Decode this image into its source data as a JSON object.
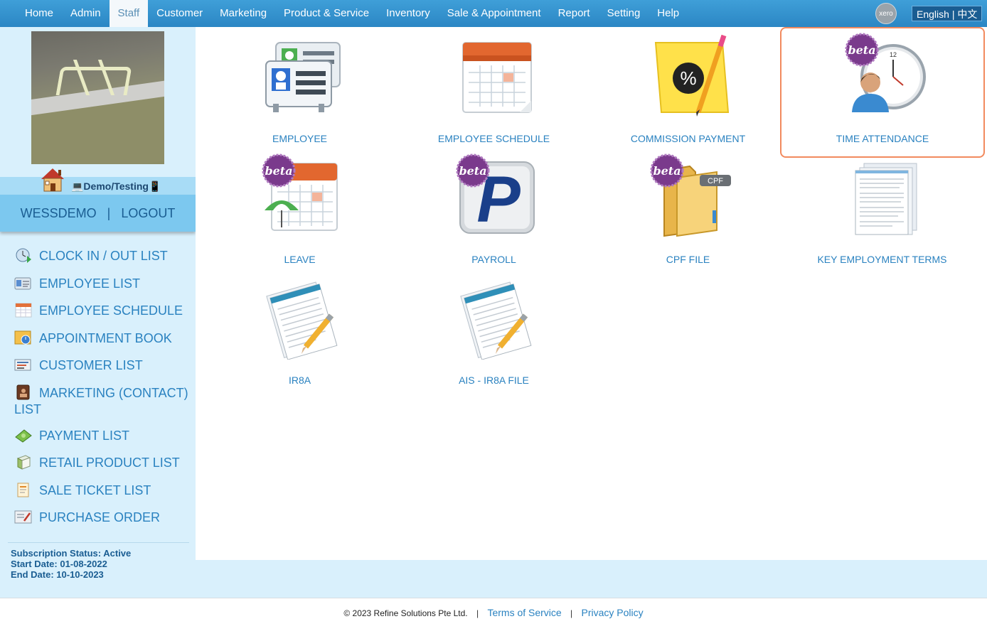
{
  "nav": {
    "items": [
      "Home",
      "Admin",
      "Staff",
      "Customer",
      "Marketing",
      "Product & Service",
      "Inventory",
      "Sale & Appointment",
      "Report",
      "Setting",
      "Help"
    ],
    "active_index": 2,
    "xero_label": "xero",
    "lang_english": "English",
    "lang_sep": "|",
    "lang_chinese": "中文"
  },
  "sidebar": {
    "shop_name": "💻Demo/Testing📱",
    "username": "WESSDEMO",
    "separator": "|",
    "logout": "LOGOUT",
    "items": [
      {
        "label": "CLOCK IN / OUT LIST",
        "icon": "clock-in-icon"
      },
      {
        "label": "EMPLOYEE LIST",
        "icon": "employee-card-icon"
      },
      {
        "label": "EMPLOYEE SCHEDULE",
        "icon": "calendar-icon"
      },
      {
        "label": "APPOINTMENT BOOK",
        "icon": "appointment-book-icon"
      },
      {
        "label": "CUSTOMER LIST",
        "icon": "customer-list-icon"
      },
      {
        "label": "MARKETING (CONTACT) LIST",
        "icon": "contact-book-icon"
      },
      {
        "label": "PAYMENT LIST",
        "icon": "money-icon"
      },
      {
        "label": "RETAIL PRODUCT LIST",
        "icon": "product-box-icon"
      },
      {
        "label": "SALE TICKET LIST",
        "icon": "sale-ticket-icon"
      },
      {
        "label": "PURCHASE ORDER",
        "icon": "purchase-order-icon"
      }
    ],
    "subscription": {
      "status": "Subscription Status: Active",
      "start": "Start Date: 01-08-2022",
      "end": "End Date: 10-10-2023"
    }
  },
  "tiles": [
    {
      "label": "EMPLOYEE",
      "icon": "employee-cards-icon",
      "beta": false
    },
    {
      "label": "EMPLOYEE SCHEDULE",
      "icon": "schedule-calendar-icon",
      "beta": false
    },
    {
      "label": "COMMISSION PAYMENT",
      "icon": "commission-note-icon",
      "beta": false
    },
    {
      "label": "TIME ATTENDANCE",
      "icon": "time-attendance-clock-icon",
      "beta": true,
      "beta_text": "beta"
    },
    {
      "label": "LEAVE",
      "icon": "leave-calendar-umbrella-icon",
      "beta": true,
      "beta_text": "beta"
    },
    {
      "label": "PAYROLL",
      "icon": "payroll-p-icon",
      "beta": true,
      "beta_text": "beta",
      "glyph": "P"
    },
    {
      "label": "CPF FILE",
      "icon": "cpf-folder-icon",
      "beta": true,
      "beta_text": "beta",
      "glyph": "CPF"
    },
    {
      "label": "KEY EMPLOYMENT TERMS",
      "icon": "document-stack-icon",
      "beta": false
    },
    {
      "label": "IR8A",
      "icon": "ir8a-document-pencil-icon",
      "beta": false
    },
    {
      "label": "AIS - IR8A FILE",
      "icon": "ais-document-pencil-icon",
      "beta": false
    }
  ],
  "commission_glyph": "%",
  "clock_number": "12",
  "footer": {
    "copyright": "© 2023 Refine Solutions Pte Ltd.",
    "pipe": "|",
    "terms": "Terms of Service",
    "privacy": "Privacy Policy"
  },
  "colors": {
    "nav_bg": "#2b86c4",
    "sidebar_bg": "#d9f0fc",
    "link": "#2a82c0",
    "highlight_border": "#f28a5e",
    "beta_badge": "#7a3a8c"
  }
}
